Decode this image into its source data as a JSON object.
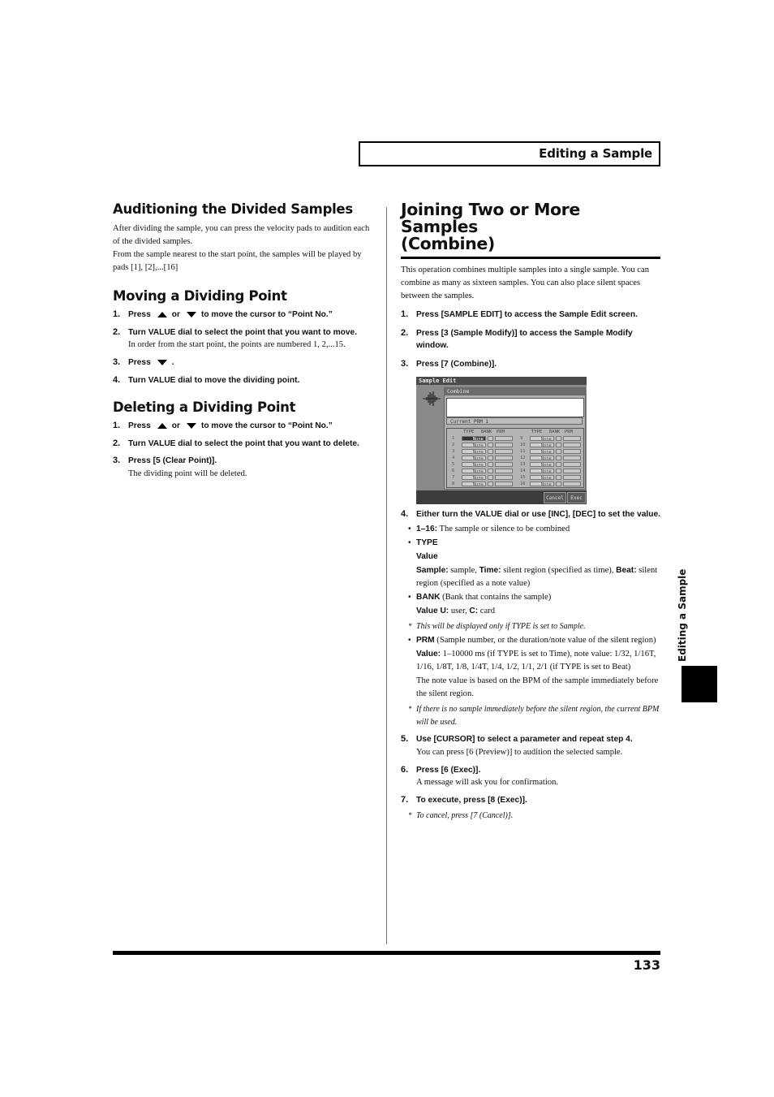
{
  "header": {
    "title": "Editing a Sample"
  },
  "left": {
    "section1": {
      "title": "Auditioning the Divided Samples",
      "paragraphs": [
        "After dividing the sample, you can press the velocity pads to audition each of the divided samples.",
        "From the sample nearest to the start point, the samples will be played by pads [1], [2],...[16]"
      ]
    },
    "section2": {
      "title": "Moving a Dividing Point",
      "steps": [
        {
          "num": "1.",
          "pre": "Press",
          "mid": "or",
          "post": "to move the cursor to “Point No.”"
        },
        {
          "num": "2.",
          "text": "Turn VALUE dial to select the point that you want to move.",
          "sub": "In order from the start point, the points are numbered 1, 2,...15."
        },
        {
          "num": "3.",
          "pre": "Press",
          "post": "."
        },
        {
          "num": "4.",
          "text": "Turn VALUE dial to move the dividing point."
        }
      ]
    },
    "section3": {
      "title": "Deleting a Dividing Point",
      "steps": [
        {
          "num": "1.",
          "pre": "Press",
          "mid": "or",
          "post": "to move the cursor to “Point No.”"
        },
        {
          "num": "2.",
          "text": "Turn VALUE dial to select the point that you want to delete."
        },
        {
          "num": "3.",
          "text": "Press [5 (Clear Point)].",
          "sub": "The dividing point will be deleted."
        }
      ]
    }
  },
  "right": {
    "title_line1": "Joining Two or More Samples",
    "title_line2": "(Combine)",
    "intro": "This operation combines multiple samples into a single sample. You can combine as many as sixteen samples. You can also place silent spaces between the samples.",
    "steps": [
      {
        "num": "1.",
        "text": "Press [SAMPLE EDIT] to access the Sample Edit screen."
      },
      {
        "num": "2.",
        "text": "Press [3 (Sample Modify)] to access the Sample Modify window."
      },
      {
        "num": "3.",
        "text": "Press [7 (Combine)]."
      },
      {
        "num": "4.",
        "text": "Either turn the VALUE dial or use [INC], [DEC] to set the value."
      },
      {
        "num": "5.",
        "text": "Use [CURSOR] to select a parameter and repeat step 4.",
        "sub": "You can press [6 (Preview)] to audition the selected sample."
      },
      {
        "num": "6.",
        "text": "Press [6 (Exec)].",
        "sub": "A message will ask you for confirmation."
      },
      {
        "num": "7.",
        "text": "To execute, press [8 (Exec)].",
        "note": "To cancel, press [7 (Cancel)]."
      }
    ],
    "bullets": {
      "b1_label": "1–16:",
      "b1_text": " The sample or silence to be combined",
      "b2_label": "TYPE",
      "b2_value_label": "Value",
      "b2_sample": "Sample:",
      "b2_sample_t": " sample, ",
      "b2_time": "Time:",
      "b2_time_t": " silent region (specified as time), ",
      "b2_beat": "Beat:",
      "b2_beat_t": " silent region (specified as a note value)",
      "b3_label": "BANK",
      "b3_text": " (Bank that contains the sample)",
      "b3_value": "Value U:",
      "b3_user": " user, ",
      "b3_c": "C:",
      "b3_card": " card",
      "note1": "This will be displayed only if TYPE is set to Sample.",
      "b4_label": "PRM",
      "b4_text": " (Sample number, or the duration/note value of the silent region)",
      "b4_value": "Value:",
      "b4_value_t": " 1–10000 ms (if TYPE is set to Time), note value: 1/32, 1/16T, 1/16, 1/8T, 1/8, 1/4T, 1/4, 1/2, 1/1, 2/1 (if TYPE is set to Beat)",
      "b4_extra": "The note value is based on the BPM of the sample immediately before the silent region.",
      "note2": "If there is no sample immediately before the silent region, the current BPM will be used."
    },
    "screen": {
      "title": "Sample Edit",
      "window_title": "Combine",
      "current": "Current PRM 1",
      "col_headers": [
        "TYPE",
        "BANK",
        "PRM"
      ],
      "rows": [
        {
          "n": "1",
          "type": "None"
        },
        {
          "n": "2",
          "type": "None"
        },
        {
          "n": "3",
          "type": "None"
        },
        {
          "n": "4",
          "type": "None"
        },
        {
          "n": "5",
          "type": "None"
        },
        {
          "n": "6",
          "type": "None"
        },
        {
          "n": "7",
          "type": "None"
        },
        {
          "n": "8",
          "type": "None"
        },
        {
          "n": "9",
          "type": "None"
        },
        {
          "n": "10",
          "type": "None"
        },
        {
          "n": "11",
          "type": "None"
        },
        {
          "n": "12",
          "type": "None"
        },
        {
          "n": "13",
          "type": "None"
        },
        {
          "n": "14",
          "type": "None"
        },
        {
          "n": "15",
          "type": "None"
        },
        {
          "n": "16",
          "type": "None"
        }
      ],
      "buttons": [
        "Cancel",
        "Exec"
      ]
    }
  },
  "side_tab": "Editing a Sample",
  "page_number": "133"
}
